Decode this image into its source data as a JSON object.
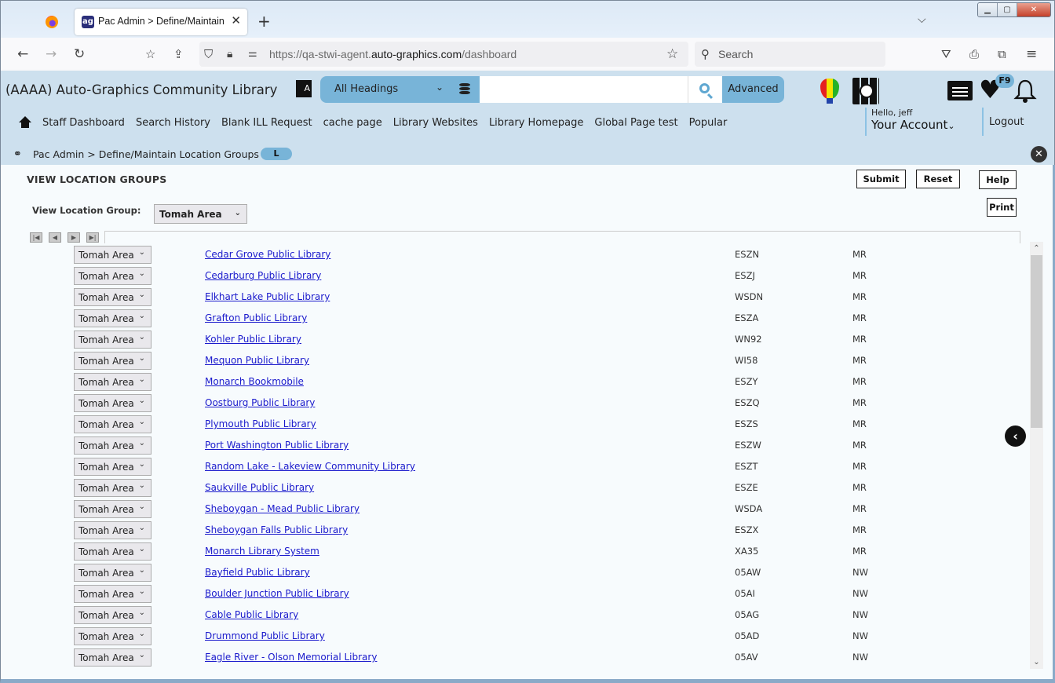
{
  "browser": {
    "tab_title": "Pac Admin > Define/Maintain Location Groups",
    "tab_title_visible": "Pac Admin > Define/Maintain L",
    "url_prefix": "https://qa-stwi-agent.",
    "url_domain": "auto-graphics.com",
    "url_path": "/dashboard",
    "search_placeholder": "Search",
    "icons": [
      "back-icon",
      "forward-icon",
      "reload-icon",
      "bookmark-import-icon",
      "share-icon",
      "shield-icon",
      "lock-icon",
      "permissions-icon",
      "star-icon",
      "pocket-icon",
      "print-icon",
      "extensions-icon",
      "menu-icon"
    ]
  },
  "header": {
    "library_name": "(AAAA) Auto-Graphics Community Library",
    "search_scope": "All Headings",
    "search_value": "",
    "advanced_label": "Advanced",
    "badge_label": "F9",
    "greeting": "Hello, jeff",
    "account_label": "Your Account",
    "logout_label": "Logout",
    "accent_color": "#78b4d8"
  },
  "menu": {
    "items": [
      "Staff Dashboard",
      "Search History",
      "Blank ILL Request",
      "cache page",
      "Library Websites",
      "Library Homepage",
      "Global Page test",
      "Popular"
    ]
  },
  "breadcrumb": {
    "text": "Pac Admin > Define/Maintain Location Groups",
    "badge": "L"
  },
  "page": {
    "title": "VIEW LOCATION GROUPS",
    "buttons": {
      "submit": "Submit",
      "reset": "Reset",
      "help": "Help",
      "print": "Print"
    },
    "view_group_label": "View Location Group:",
    "view_group_value": "Tomah Area",
    "pager": [
      "first",
      "previous",
      "next",
      "last"
    ]
  },
  "rows": [
    {
      "group": "Tomah Area",
      "name": "Cedar Grove Public Library",
      "code": "ESZN",
      "region": "MR"
    },
    {
      "group": "Tomah Area",
      "name": "Cedarburg Public Library",
      "code": "ESZJ",
      "region": "MR"
    },
    {
      "group": "Tomah Area",
      "name": "Elkhart Lake Public Library",
      "code": "WSDN",
      "region": "MR"
    },
    {
      "group": "Tomah Area",
      "name": "Grafton Public Library",
      "code": "ESZA",
      "region": "MR"
    },
    {
      "group": "Tomah Area",
      "name": "Kohler Public Library",
      "code": "WN92",
      "region": "MR"
    },
    {
      "group": "Tomah Area",
      "name": "Mequon Public Library",
      "code": "WI58",
      "region": "MR"
    },
    {
      "group": "Tomah Area",
      "name": "Monarch Bookmobile",
      "code": "ESZY",
      "region": "MR"
    },
    {
      "group": "Tomah Area",
      "name": "Oostburg Public Library",
      "code": "ESZQ",
      "region": "MR"
    },
    {
      "group": "Tomah Area",
      "name": "Plymouth Public Library",
      "code": "ESZS",
      "region": "MR"
    },
    {
      "group": "Tomah Area",
      "name": "Port Washington Public Library",
      "code": "ESZW",
      "region": "MR"
    },
    {
      "group": "Tomah Area",
      "name": "Random Lake - Lakeview Community Library",
      "code": "ESZT",
      "region": "MR"
    },
    {
      "group": "Tomah Area",
      "name": "Saukville Public Library",
      "code": "ESZE",
      "region": "MR"
    },
    {
      "group": "Tomah Area",
      "name": "Sheboygan - Mead Public Library",
      "code": "WSDA",
      "region": "MR"
    },
    {
      "group": "Tomah Area",
      "name": "Sheboygan Falls Public Library",
      "code": "ESZX",
      "region": "MR"
    },
    {
      "group": "Tomah Area",
      "name": "Monarch Library System",
      "code": "XA35",
      "region": "MR"
    },
    {
      "group": "Tomah Area",
      "name": "Bayfield Public Library",
      "code": "05AW",
      "region": "NW"
    },
    {
      "group": "Tomah Area",
      "name": "Boulder Junction Public Library",
      "code": "05AI",
      "region": "NW"
    },
    {
      "group": "Tomah Area",
      "name": "Cable Public Library",
      "code": "05AG",
      "region": "NW"
    },
    {
      "group": "Tomah Area",
      "name": "Drummond Public Library",
      "code": "05AD",
      "region": "NW"
    },
    {
      "group": "Tomah Area",
      "name": "Eagle River - Olson Memorial Library",
      "code": "05AV",
      "region": "NW"
    }
  ]
}
